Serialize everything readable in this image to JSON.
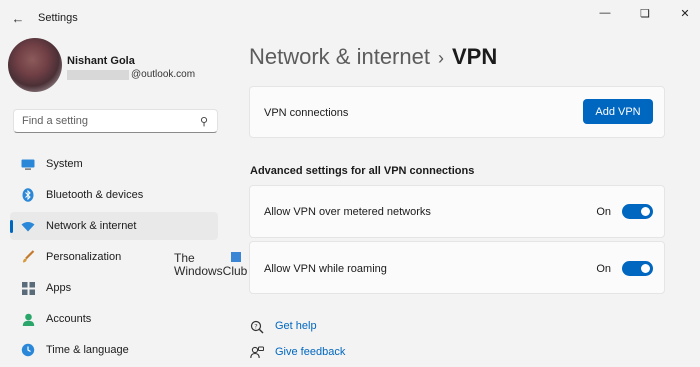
{
  "window": {
    "title": "Settings",
    "back_icon": "arrow-left-icon",
    "controls": [
      "minimize-icon",
      "maximize-icon",
      "close-icon"
    ]
  },
  "profile": {
    "name": "Nishant Gola",
    "email": "@outlook.com"
  },
  "search": {
    "placeholder": "Find a setting",
    "icon": "search-icon"
  },
  "sidebar": {
    "items": [
      {
        "label": "System",
        "icon": "monitor-icon",
        "active": false
      },
      {
        "label": "Bluetooth & devices",
        "icon": "bluetooth-icon",
        "active": false
      },
      {
        "label": "Network & internet",
        "icon": "wifi-icon",
        "active": true
      },
      {
        "label": "Personalization",
        "icon": "brush-icon",
        "active": false
      },
      {
        "label": "Apps",
        "icon": "apps-icon",
        "active": false
      },
      {
        "label": "Accounts",
        "icon": "person-icon",
        "active": false
      },
      {
        "label": "Time & language",
        "icon": "globe-clock-icon",
        "active": false
      }
    ]
  },
  "watermark": {
    "line1": "The",
    "line2": "WindowsClub"
  },
  "breadcrumb": {
    "parent": "Network & internet",
    "separator": "›",
    "current": "VPN"
  },
  "vpn_connections": {
    "label": "VPN connections",
    "button_label": "Add VPN"
  },
  "advanced": {
    "title": "Advanced settings for all VPN connections",
    "settings": [
      {
        "label": "Allow VPN over metered networks",
        "state_text": "On",
        "on": true
      },
      {
        "label": "Allow VPN while roaming",
        "state_text": "On",
        "on": true
      }
    ]
  },
  "links": {
    "help": "Get help",
    "feedback": "Give feedback"
  },
  "colors": {
    "accent": "#0067c0",
    "background": "#f3f3f3",
    "card": "#fbfbfb"
  }
}
